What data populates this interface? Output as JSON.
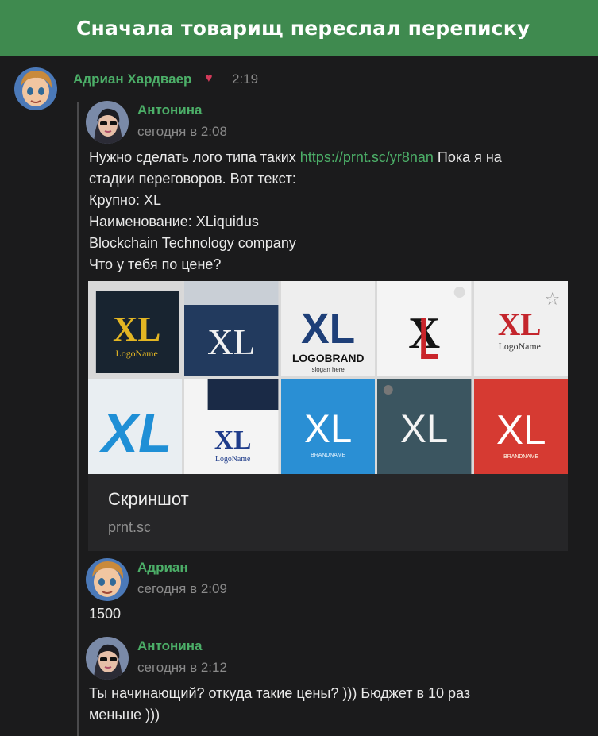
{
  "header": {
    "title": "Сначала товарищ переслал переписку"
  },
  "post": {
    "author": "Адриан Хардваер",
    "time": "2:19",
    "heart_icon": "heart-icon"
  },
  "forwarded": [
    {
      "author": "Антонина",
      "time": "сегодня в 2:08",
      "text_before_link": "Нужно сделать лого типа таких ",
      "link": "https://prnt.sc/yr8nan",
      "lines": [
        " Пока я на",
        "стадии переговоров. Вот текст:",
        "Крупно: XL",
        "Наименование: XLiquidus",
        "Blockchain Technology company",
        "Что у тебя по цене?"
      ],
      "preview": {
        "title": "Скриншот",
        "domain": "prnt.sc",
        "tiles": [
          {
            "label": "LogoName",
            "mark": "XL"
          },
          {
            "label": "",
            "mark": "XL"
          },
          {
            "label": "LOGOBRAND",
            "sub": "slogan here",
            "mark": "XL"
          },
          {
            "label": "",
            "mark": "XL"
          },
          {
            "label": "LogoName",
            "mark": "XL"
          },
          {
            "label": "",
            "mark": "XL"
          },
          {
            "label": "LogoName",
            "mark": "XL"
          },
          {
            "label": "BRANDNAME",
            "mark": "XL"
          },
          {
            "label": "",
            "mark": "XL"
          },
          {
            "label": "BRANDNAME",
            "mark": "XL"
          }
        ]
      }
    },
    {
      "author": "Адриан",
      "time": "сегодня в 2:09",
      "text": "1500"
    },
    {
      "author": "Антонина",
      "time": "сегодня в 2:12",
      "lines": [
        "Ты начинающий? откуда такие цены? ))) Бюджет в 10 раз",
        "меньше )))"
      ]
    }
  ],
  "colors": {
    "accent": "#4caf68",
    "header": "#3f8a4f",
    "background": "#1b1b1c"
  }
}
